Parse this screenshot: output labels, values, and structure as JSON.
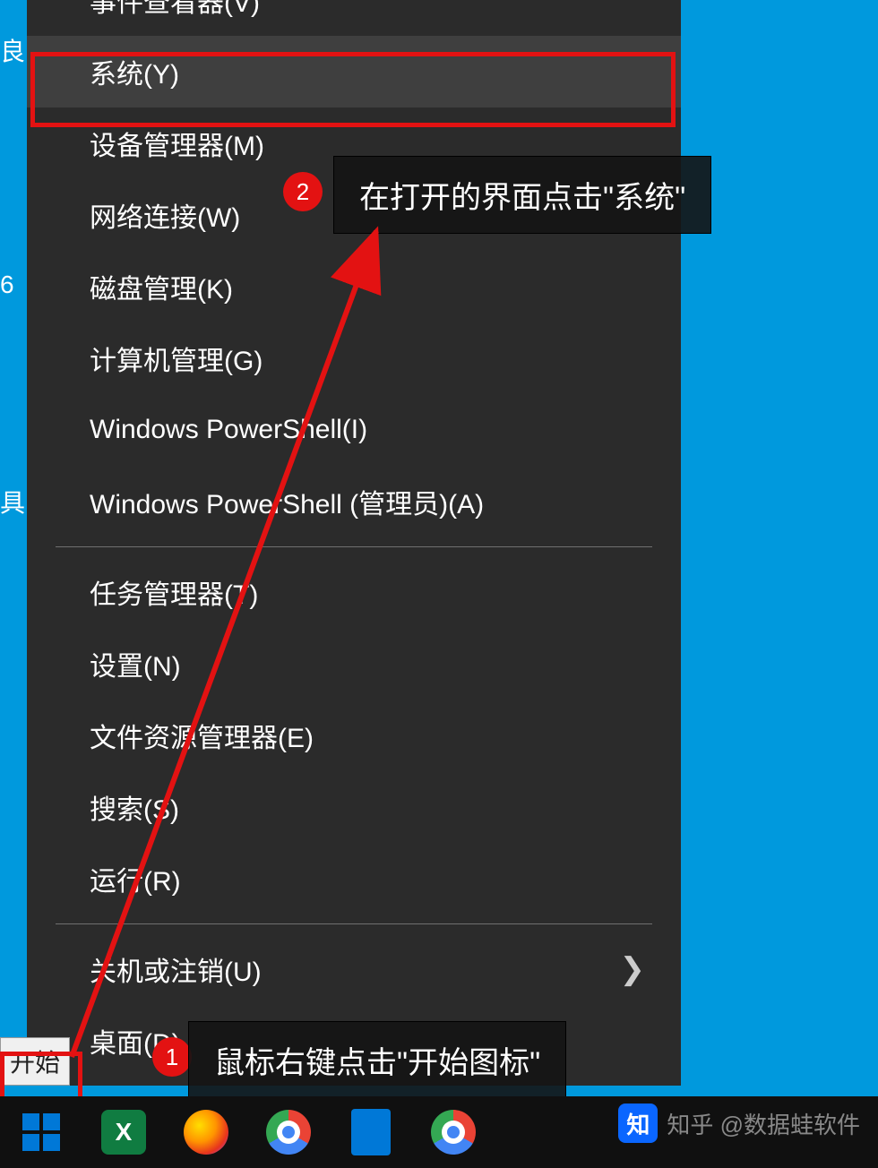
{
  "desktop": {
    "snippet_top": "良",
    "snippet_mid": "6",
    "snippet_lower": "具"
  },
  "menu": {
    "items": [
      {
        "label": "事件查看器(V)"
      },
      {
        "label": "系统(Y)"
      },
      {
        "label": "设备管理器(M)"
      },
      {
        "label": "网络连接(W)"
      },
      {
        "label": "磁盘管理(K)"
      },
      {
        "label": "计算机管理(G)"
      },
      {
        "label": "Windows PowerShell(I)"
      },
      {
        "label": "Windows PowerShell (管理员)(A)"
      }
    ],
    "group2": [
      {
        "label": "任务管理器(T)"
      },
      {
        "label": "设置(N)"
      },
      {
        "label": "文件资源管理器(E)"
      },
      {
        "label": "搜索(S)"
      },
      {
        "label": "运行(R)"
      }
    ],
    "group3": [
      {
        "label": "关机或注销(U)",
        "has_chevron": true
      },
      {
        "label": "桌面(D)"
      }
    ]
  },
  "start_tooltip": "开始",
  "annotations": {
    "badge1": "1",
    "bubble1": "鼠标右键点击\"开始图标\"",
    "badge2": "2",
    "bubble2": "在打开的界面点击\"系统\""
  },
  "taskbar": {
    "icons": [
      "excel",
      "firefox",
      "chrome",
      "vscode",
      "chrome2"
    ]
  },
  "watermark": {
    "logo": "知",
    "text": "知乎 @数据蛙软件"
  }
}
